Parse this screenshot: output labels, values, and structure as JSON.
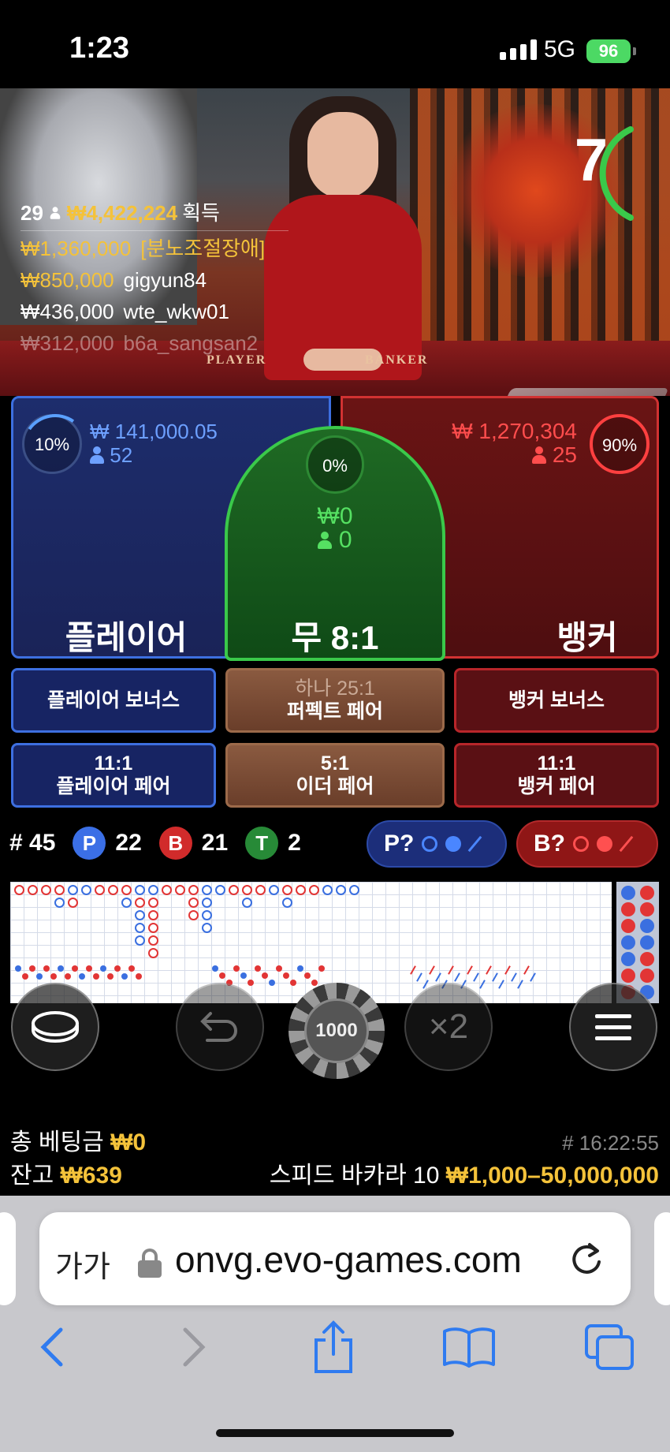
{
  "status_bar": {
    "time": "1:23",
    "network": "5G",
    "battery": "96"
  },
  "timer": {
    "seconds": "7"
  },
  "winners": {
    "count": "29",
    "total": "₩4,422,224",
    "total_label": "획득",
    "list": [
      {
        "amount": "₩1,360,000",
        "name": "[분노조절장애]"
      },
      {
        "amount": "₩850,000",
        "name": "gigyun84"
      },
      {
        "amount": "₩436,000",
        "name": "wte_wkw01"
      },
      {
        "amount": "₩312,000",
        "name": "b6a_sangsan2"
      }
    ]
  },
  "felt": {
    "player": "PLAYER",
    "banker": "BANKER"
  },
  "player": {
    "percent": "10%",
    "amount": "₩ 141,000.05",
    "players": "52",
    "label": "플레이어"
  },
  "tie": {
    "percent": "0%",
    "amount": "₩0",
    "players": "0",
    "label": "무 8:1"
  },
  "banker": {
    "percent": "90%",
    "amount": "₩ 1,270,304",
    "players": "25",
    "label": "뱅커"
  },
  "side_bets": {
    "player_bonus": "플레이어 보너스",
    "perfect_pair_odds": "하나 25:1",
    "perfect_pair": "퍼펙트 페어",
    "banker_bonus": "뱅커 보너스",
    "player_pair_odds": "11:1",
    "player_pair": "플레이어 페어",
    "either_pair_odds": "5:1",
    "either_pair": "이더 페어",
    "banker_pair_odds": "11:1",
    "banker_pair": "뱅커 페어"
  },
  "stats": {
    "round": "# 45",
    "p_letter": "P",
    "p_count": "22",
    "b_letter": "B",
    "b_count": "21",
    "t_letter": "T",
    "t_count": "2"
  },
  "predictions": {
    "player": "P?",
    "banker": "B?"
  },
  "chip": {
    "value": "1000"
  },
  "controls": {
    "double": "×2"
  },
  "footer": {
    "total_bet_label": "총 베팅금",
    "total_bet": "₩0",
    "balance_label": "잔고",
    "balance": "₩639",
    "round_id": "# 16:22:55",
    "table_name": "스피드 바카라 10",
    "limits": "₩1,000–50,000,000"
  },
  "browser": {
    "text_size": "가가",
    "url": "onvg.evo-games.com"
  },
  "colors": {
    "player": "#3b6fe6",
    "banker": "#d12b2b",
    "tie": "#278a37",
    "gold": "#f4c23a",
    "ios_blue": "#2f7bf0"
  }
}
